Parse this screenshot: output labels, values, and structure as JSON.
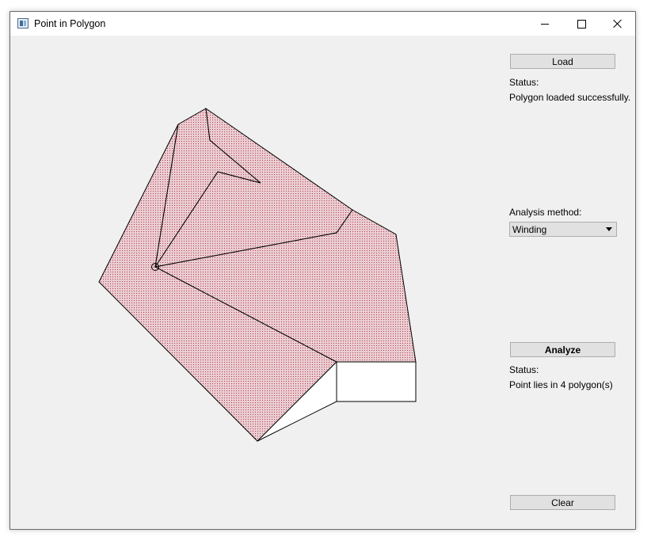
{
  "window": {
    "title": "Point in Polygon"
  },
  "toolbar": {
    "load_label": "Load",
    "load_status_label": "Status:",
    "load_status_text": "Polygon loaded successfully.",
    "method_label": "Analysis method:",
    "method_selected": "Winding",
    "analyze_label": "Analyze",
    "analyze_status_label": "Status:",
    "analyze_status_text": "Point lies in 4 polygon(s)",
    "clear_label": "Clear"
  },
  "colors": {
    "fill": "#e8b8c0",
    "dots": "#b03040",
    "background": "#f0f0f0"
  },
  "icons": [
    "app-icon",
    "minimize-icon",
    "maximize-icon",
    "close-icon",
    "chevron-down-icon"
  ]
}
